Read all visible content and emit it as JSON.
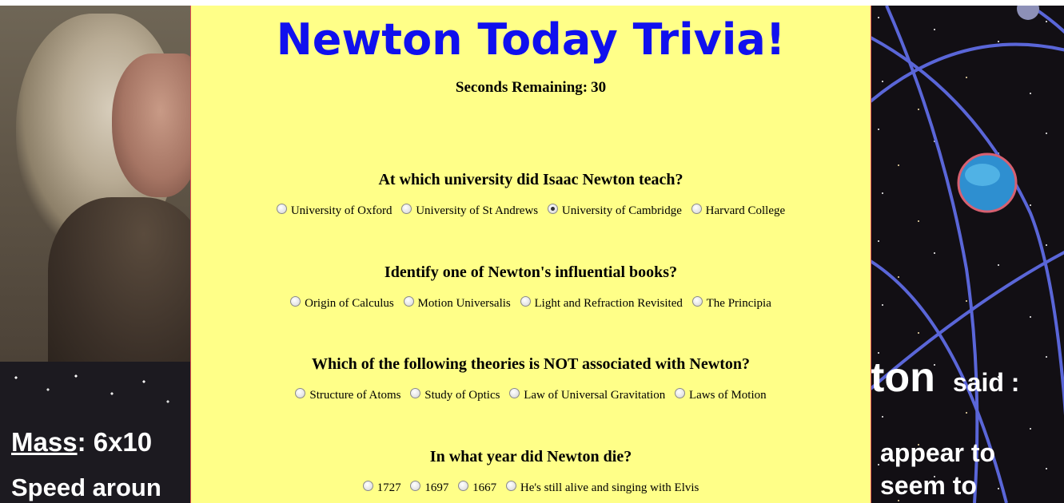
{
  "quiz": {
    "title": "Newton Today Trivia!",
    "timer_label": "Seconds Remaining:",
    "seconds_remaining": "30",
    "questions": [
      {
        "text": "At which university did Isaac Newton teach?",
        "options": [
          "University of Oxford",
          "University of St Andrews",
          "University of Cambridge",
          "Harvard College"
        ],
        "selected": 2
      },
      {
        "text": "Identify one of Newton's influential books?",
        "options": [
          "Origin of Calculus",
          "Motion Universalis",
          "Light and Refraction Revisited",
          "The Principia"
        ],
        "selected": null
      },
      {
        "text": "Which of the following theories is NOT associated with Newton?",
        "options": [
          "Structure of Atoms",
          "Study of Optics",
          "Law of Universal Gravitation",
          "Laws of Motion"
        ],
        "selected": null
      },
      {
        "text": "In what year did Newton die?",
        "options": [
          "1727",
          "1697",
          "1667",
          "He's still alive and singing with Elvis"
        ],
        "selected": null
      }
    ]
  },
  "background": {
    "left_mass_label": "Mass",
    "left_mass_value": ": 6x10",
    "left_speed": "Speed aroun",
    "right_big": "ton",
    "right_said": "said :",
    "right_line1": "appear to",
    "right_line2": "seem to"
  },
  "colors": {
    "panel_background": "#ffff88",
    "title_color": "#1010ee",
    "panel_border": "#e05050"
  }
}
